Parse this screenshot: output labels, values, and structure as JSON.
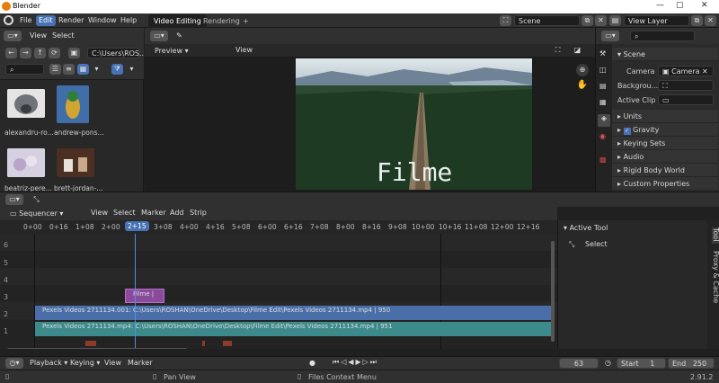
{
  "app": {
    "title": "Blender",
    "version": "2.91.2"
  },
  "menu": {
    "items": [
      "File",
      "Edit",
      "Render",
      "Window",
      "Help"
    ],
    "active": "Edit"
  },
  "workspaces": {
    "tabs": [
      "Video Editing",
      "Rendering"
    ],
    "add": "+",
    "active": "Video Editing"
  },
  "scene_field": "Scene",
  "view_layer_field": "View Layer",
  "filebrowser": {
    "view_label": "View",
    "select_label": "Select",
    "path": "C:\\Users\\ROS...",
    "files": [
      {
        "label": "alexandru-ro...",
        "color": "#8a8f94"
      },
      {
        "label": "andrew-pons...",
        "color": "#3f6ea8"
      },
      {
        "label": "beatriz-pere...",
        "color": "#c8c3d6"
      },
      {
        "label": "brett-jordan-...",
        "color": "#5a3b2a"
      }
    ]
  },
  "preview": {
    "mode_label": "Preview",
    "view_label": "View",
    "overlay_text": "Filme"
  },
  "properties": {
    "camera_label": "Camera",
    "camera_value": "Camera",
    "background_label": "Backgrou...",
    "active_clip_label": "Active Clip",
    "sections": [
      "Scene",
      "Units",
      "Gravity",
      "Keying Sets",
      "Audio",
      "Rigid Body World",
      "Custom Properties"
    ]
  },
  "sequencer": {
    "editor_label": "Sequencer",
    "menus": [
      "View",
      "Select",
      "Marker",
      "Add",
      "Strip"
    ],
    "ruler": [
      "0+00",
      "0+16",
      "1+08",
      "2+00",
      "2+15",
      "3+08",
      "4+00",
      "4+16",
      "5+08",
      "6+00",
      "6+16",
      "7+08",
      "8+00",
      "8+16",
      "9+08",
      "10+00",
      "10+16",
      "11+08",
      "12+00",
      "12+16"
    ],
    "current_frame_label": "2+15",
    "channels": [
      "6",
      "5",
      "4",
      "3",
      "2",
      "1"
    ],
    "strips": [
      {
        "channel": 3,
        "text": "Filme |",
        "color": "#8b4b9c"
      },
      {
        "channel": 2,
        "text": "Pexels Videos 2711134.001: C:\\Users\\ROSHAN\\OneDrive\\Desktop\\Filme Edit\\Pexels Videos 2711134.mp4 | 950",
        "color": "#4a6fa8"
      },
      {
        "channel": 1,
        "text": "Pexels Videos 2711134.mp4: C:\\Users\\ROSHAN\\OneDrive\\Desktop\\Filme Edit\\Pexels Videos 2711134.mp4 | 951",
        "color": "#3d8a8a"
      }
    ]
  },
  "active_tool": {
    "title": "Active Tool",
    "tool": "Select",
    "side_tabs": [
      "Tool",
      "Proxy & Cache"
    ]
  },
  "timeline": {
    "menus": [
      "Playback",
      "Keying",
      "View",
      "Marker"
    ],
    "frame": "63",
    "start_label": "Start",
    "start": "1",
    "end_label": "End",
    "end": "250"
  },
  "status": {
    "left": "Pan View",
    "middle": "Files Context Menu"
  }
}
